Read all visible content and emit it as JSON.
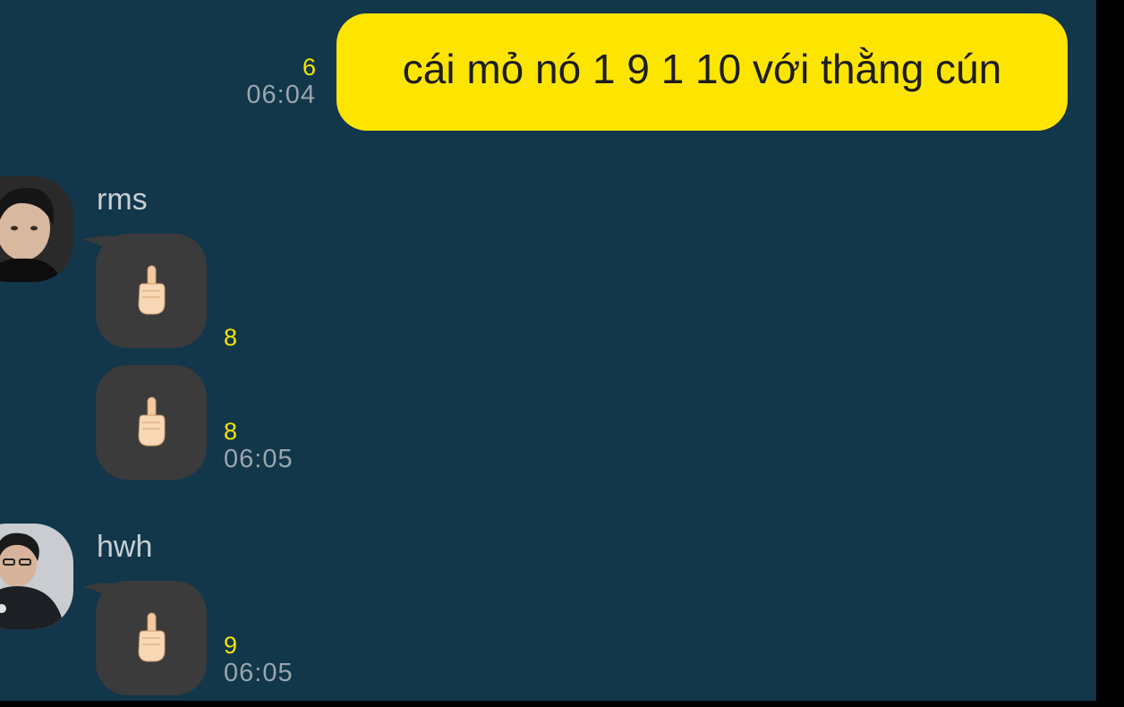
{
  "outgoing": {
    "message": "cái mỏ nó 1 9 1 10 với thằng cún",
    "unread_count": "6",
    "time": "06:04",
    "bubble_color": "#fee500"
  },
  "groups": [
    {
      "sender": "rms",
      "messages": [
        {
          "emoji_icon": "middle-finger-emoji",
          "unread_count": "8",
          "time": ""
        },
        {
          "emoji_icon": "middle-finger-emoji",
          "unread_count": "8",
          "time": "06:05"
        }
      ]
    },
    {
      "sender": "hwh",
      "messages": [
        {
          "emoji_icon": "middle-finger-emoji",
          "unread_count": "9",
          "time": "06:05"
        }
      ]
    }
  ],
  "colors": {
    "chat_background": "#12364a",
    "incoming_bubble": "#3b3b3b",
    "unread_accent": "#f5e400",
    "timestamp": "#9aa6ae"
  }
}
